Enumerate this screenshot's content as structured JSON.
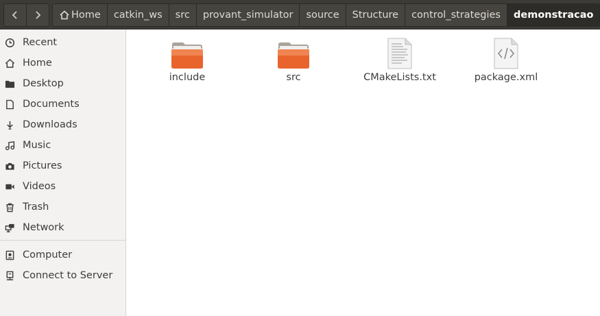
{
  "nav": {
    "back_icon": "chevron-left-icon",
    "forward_icon": "chevron-right-icon"
  },
  "breadcrumbs": [
    "Home",
    "catkin_ws",
    "src",
    "provant_simulator",
    "source",
    "Structure",
    "control_strategies",
    "demonstracao"
  ],
  "sidebar": {
    "items": [
      {
        "label": "Recent",
        "icon": "clock-icon"
      },
      {
        "label": "Home",
        "icon": "home-icon"
      },
      {
        "label": "Desktop",
        "icon": "folder-icon"
      },
      {
        "label": "Documents",
        "icon": "document-icon"
      },
      {
        "label": "Downloads",
        "icon": "download-icon"
      },
      {
        "label": "Music",
        "icon": "music-icon"
      },
      {
        "label": "Pictures",
        "icon": "camera-icon"
      },
      {
        "label": "Videos",
        "icon": "video-icon"
      },
      {
        "label": "Trash",
        "icon": "trash-icon"
      },
      {
        "label": "Network",
        "icon": "network-icon"
      },
      {
        "label": "Computer",
        "icon": "computer-icon"
      },
      {
        "label": "Connect to Server",
        "icon": "server-icon"
      }
    ]
  },
  "files": [
    {
      "name": "include",
      "type": "folder"
    },
    {
      "name": "src",
      "type": "folder"
    },
    {
      "name": "CMakeLists.txt",
      "type": "text"
    },
    {
      "name": "package.xml",
      "type": "xml"
    }
  ],
  "colors": {
    "topbar": "#3c3b37",
    "folder_orange": "#e8642c",
    "sidebar_bg": "#f3f2f1"
  }
}
